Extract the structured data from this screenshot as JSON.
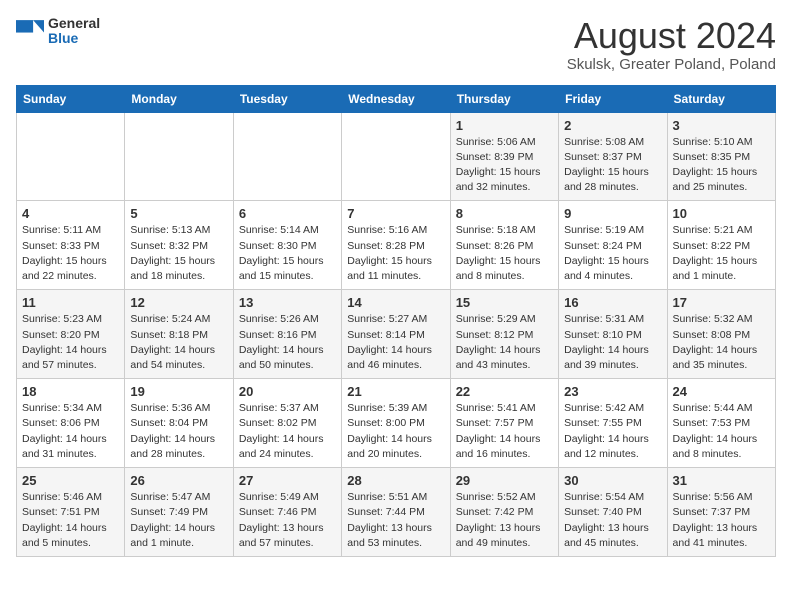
{
  "logo": {
    "general": "General",
    "blue": "Blue"
  },
  "title": "August 2024",
  "subtitle": "Skulsk, Greater Poland, Poland",
  "days_header": [
    "Sunday",
    "Monday",
    "Tuesday",
    "Wednesday",
    "Thursday",
    "Friday",
    "Saturday"
  ],
  "weeks": [
    [
      {
        "day": "",
        "info": ""
      },
      {
        "day": "",
        "info": ""
      },
      {
        "day": "",
        "info": ""
      },
      {
        "day": "",
        "info": ""
      },
      {
        "day": "1",
        "info": "Sunrise: 5:06 AM\nSunset: 8:39 PM\nDaylight: 15 hours\nand 32 minutes."
      },
      {
        "day": "2",
        "info": "Sunrise: 5:08 AM\nSunset: 8:37 PM\nDaylight: 15 hours\nand 28 minutes."
      },
      {
        "day": "3",
        "info": "Sunrise: 5:10 AM\nSunset: 8:35 PM\nDaylight: 15 hours\nand 25 minutes."
      }
    ],
    [
      {
        "day": "4",
        "info": "Sunrise: 5:11 AM\nSunset: 8:33 PM\nDaylight: 15 hours\nand 22 minutes."
      },
      {
        "day": "5",
        "info": "Sunrise: 5:13 AM\nSunset: 8:32 PM\nDaylight: 15 hours\nand 18 minutes."
      },
      {
        "day": "6",
        "info": "Sunrise: 5:14 AM\nSunset: 8:30 PM\nDaylight: 15 hours\nand 15 minutes."
      },
      {
        "day": "7",
        "info": "Sunrise: 5:16 AM\nSunset: 8:28 PM\nDaylight: 15 hours\nand 11 minutes."
      },
      {
        "day": "8",
        "info": "Sunrise: 5:18 AM\nSunset: 8:26 PM\nDaylight: 15 hours\nand 8 minutes."
      },
      {
        "day": "9",
        "info": "Sunrise: 5:19 AM\nSunset: 8:24 PM\nDaylight: 15 hours\nand 4 minutes."
      },
      {
        "day": "10",
        "info": "Sunrise: 5:21 AM\nSunset: 8:22 PM\nDaylight: 15 hours\nand 1 minute."
      }
    ],
    [
      {
        "day": "11",
        "info": "Sunrise: 5:23 AM\nSunset: 8:20 PM\nDaylight: 14 hours\nand 57 minutes."
      },
      {
        "day": "12",
        "info": "Sunrise: 5:24 AM\nSunset: 8:18 PM\nDaylight: 14 hours\nand 54 minutes."
      },
      {
        "day": "13",
        "info": "Sunrise: 5:26 AM\nSunset: 8:16 PM\nDaylight: 14 hours\nand 50 minutes."
      },
      {
        "day": "14",
        "info": "Sunrise: 5:27 AM\nSunset: 8:14 PM\nDaylight: 14 hours\nand 46 minutes."
      },
      {
        "day": "15",
        "info": "Sunrise: 5:29 AM\nSunset: 8:12 PM\nDaylight: 14 hours\nand 43 minutes."
      },
      {
        "day": "16",
        "info": "Sunrise: 5:31 AM\nSunset: 8:10 PM\nDaylight: 14 hours\nand 39 minutes."
      },
      {
        "day": "17",
        "info": "Sunrise: 5:32 AM\nSunset: 8:08 PM\nDaylight: 14 hours\nand 35 minutes."
      }
    ],
    [
      {
        "day": "18",
        "info": "Sunrise: 5:34 AM\nSunset: 8:06 PM\nDaylight: 14 hours\nand 31 minutes."
      },
      {
        "day": "19",
        "info": "Sunrise: 5:36 AM\nSunset: 8:04 PM\nDaylight: 14 hours\nand 28 minutes."
      },
      {
        "day": "20",
        "info": "Sunrise: 5:37 AM\nSunset: 8:02 PM\nDaylight: 14 hours\nand 24 minutes."
      },
      {
        "day": "21",
        "info": "Sunrise: 5:39 AM\nSunset: 8:00 PM\nDaylight: 14 hours\nand 20 minutes."
      },
      {
        "day": "22",
        "info": "Sunrise: 5:41 AM\nSunset: 7:57 PM\nDaylight: 14 hours\nand 16 minutes."
      },
      {
        "day": "23",
        "info": "Sunrise: 5:42 AM\nSunset: 7:55 PM\nDaylight: 14 hours\nand 12 minutes."
      },
      {
        "day": "24",
        "info": "Sunrise: 5:44 AM\nSunset: 7:53 PM\nDaylight: 14 hours\nand 8 minutes."
      }
    ],
    [
      {
        "day": "25",
        "info": "Sunrise: 5:46 AM\nSunset: 7:51 PM\nDaylight: 14 hours\nand 5 minutes."
      },
      {
        "day": "26",
        "info": "Sunrise: 5:47 AM\nSunset: 7:49 PM\nDaylight: 14 hours\nand 1 minute."
      },
      {
        "day": "27",
        "info": "Sunrise: 5:49 AM\nSunset: 7:46 PM\nDaylight: 13 hours\nand 57 minutes."
      },
      {
        "day": "28",
        "info": "Sunrise: 5:51 AM\nSunset: 7:44 PM\nDaylight: 13 hours\nand 53 minutes."
      },
      {
        "day": "29",
        "info": "Sunrise: 5:52 AM\nSunset: 7:42 PM\nDaylight: 13 hours\nand 49 minutes."
      },
      {
        "day": "30",
        "info": "Sunrise: 5:54 AM\nSunset: 7:40 PM\nDaylight: 13 hours\nand 45 minutes."
      },
      {
        "day": "31",
        "info": "Sunrise: 5:56 AM\nSunset: 7:37 PM\nDaylight: 13 hours\nand 41 minutes."
      }
    ]
  ]
}
